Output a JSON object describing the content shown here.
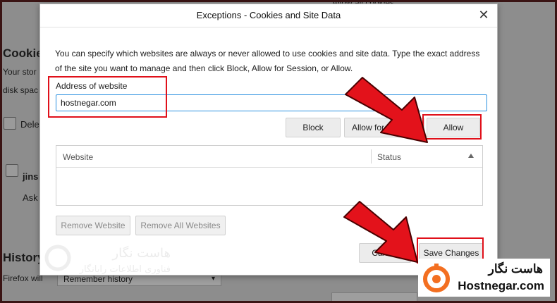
{
  "dialog": {
    "title": "Exceptions - Cookies and Site Data",
    "description": "You can specify which websites are always or never allowed to use cookies and site data. Type the exact address of the site you want to manage and then click Block, Allow for Session, or Allow.",
    "address_label": "Address of website",
    "address_value": "hostnegar.com",
    "buttons": {
      "block": "Block",
      "allow_session": "Allow for Session",
      "allow": "Allow",
      "remove_website": "Remove Website",
      "remove_all": "Remove All Websites",
      "cancel": "Cancel",
      "save": "Save Changes"
    },
    "table": {
      "col_website": "Website",
      "col_status": "Status"
    }
  },
  "background": {
    "cookies_heading": "Cookies",
    "storage_text_1": "Your stor",
    "storage_text_2": "disk spac",
    "delete_label": "Dele",
    "block_label": "jins",
    "ask_label": "Ask",
    "history_heading": "History",
    "firefox_will": "Firefox will",
    "remember_history": "Remember history",
    "top_text": "Allow all cookies"
  },
  "watermark": {
    "fa_title": "هاست نگار",
    "fa_sub": "فناوری اطلاعات رایانگار"
  },
  "brand": {
    "fa_name": "هاست نگار",
    "en_name": "Hostnegar.com",
    "accent": "#f36f21"
  },
  "colors": {
    "highlight": "#e0101a",
    "arrow": "#e3121b",
    "focus": "#2a90e0"
  }
}
